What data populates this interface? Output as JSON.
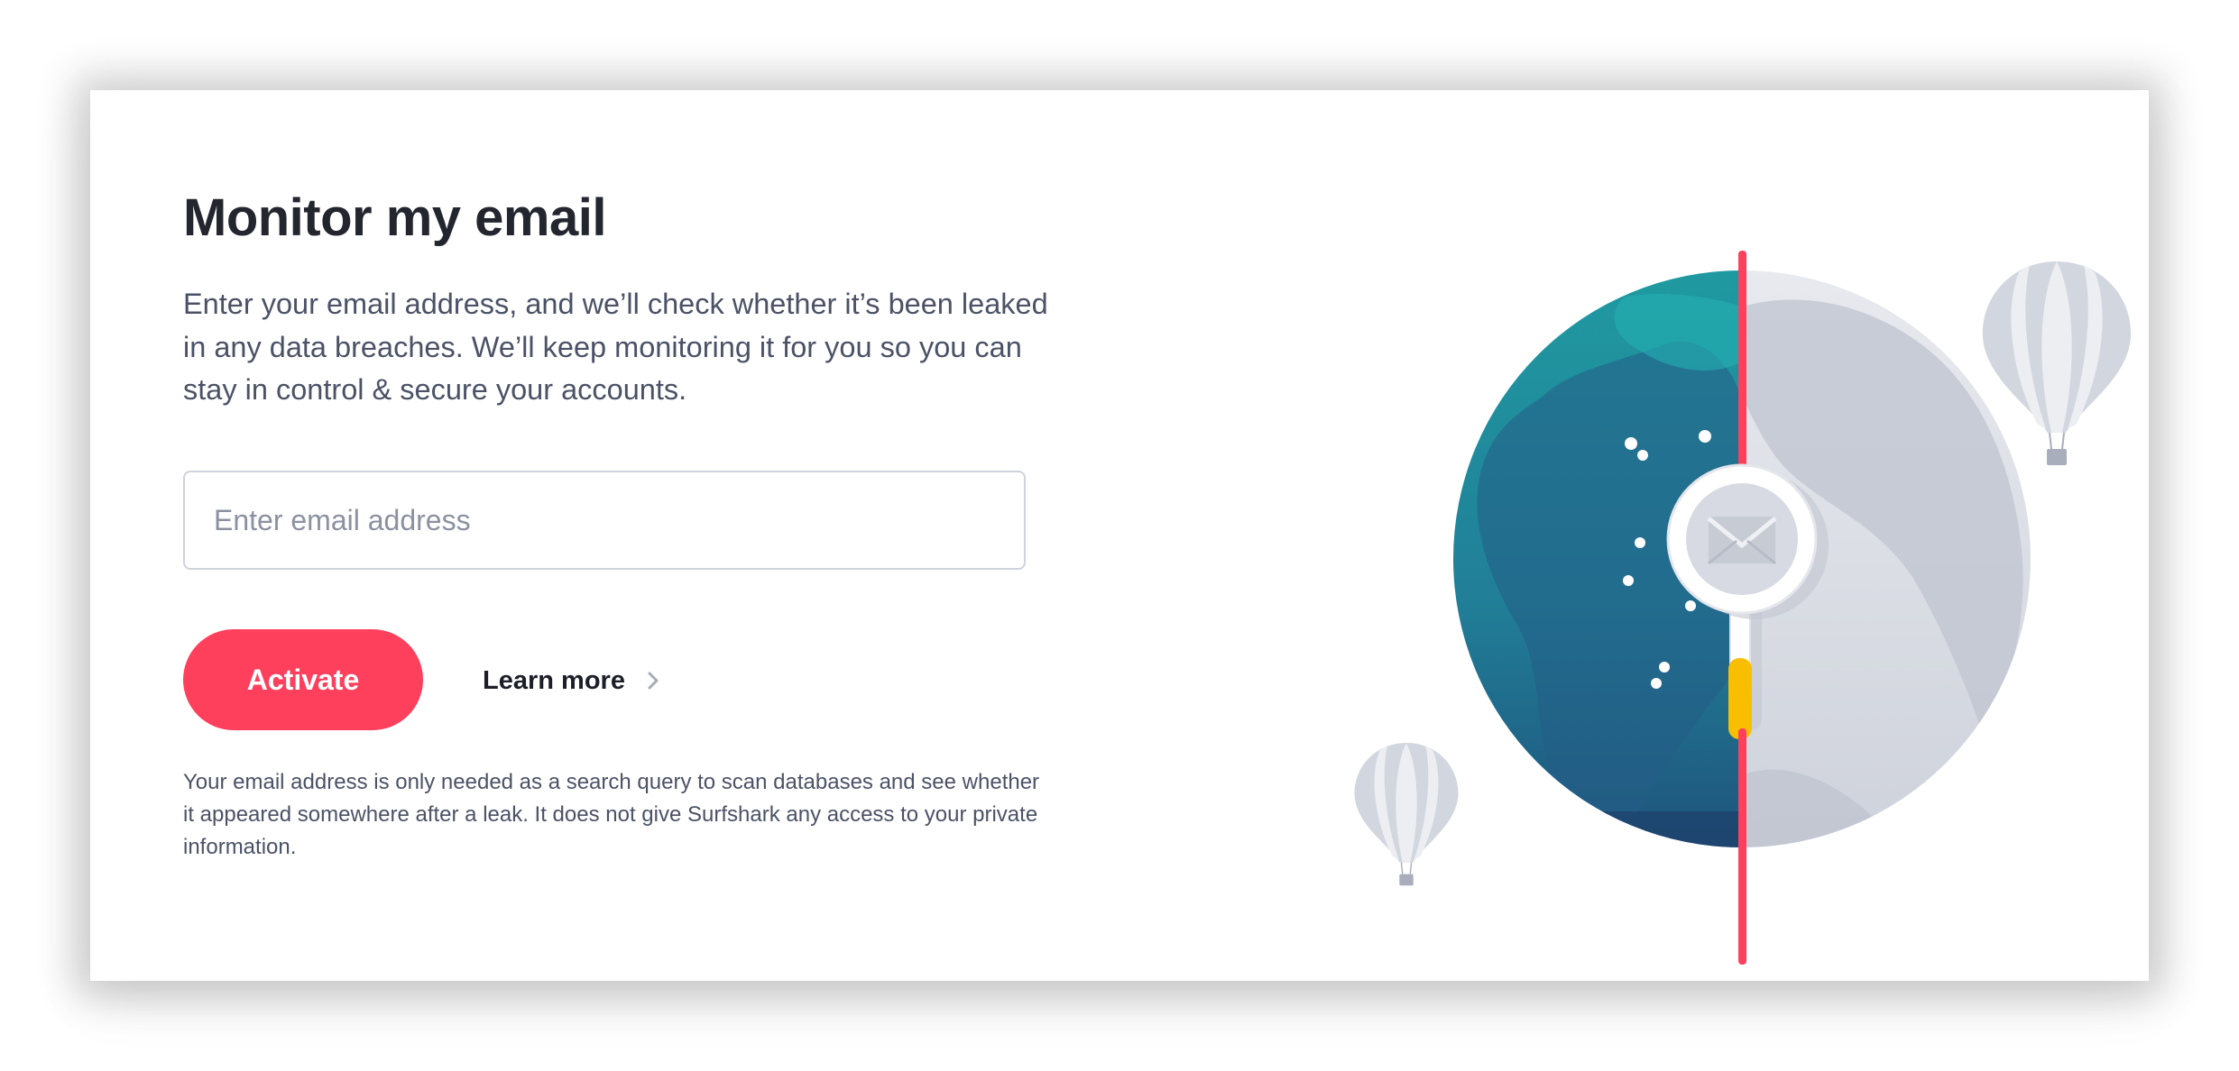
{
  "monitor": {
    "title": "Monitor my email",
    "description": "Enter your email address, and we’ll check whether it’s been leaked in any data breaches. We’ll keep monitoring it for you so you can stay in control & secure your accounts.",
    "email_placeholder": "Enter email address",
    "email_value": "",
    "activate_label": "Activate",
    "learn_more_label": "Learn more",
    "disclaimer": "Your email address is only needed as a search query to scan databases and see whether it appeared somewhere after a leak. It does not give Surfshark any access to your private information."
  },
  "theme": {
    "accent": "#ff405d",
    "title_color": "#23262e",
    "body_text": "#4b5266",
    "input_border": "#cfd3de"
  },
  "illustration": {
    "icons": [
      "globe-icon",
      "magnifier-icon",
      "envelope-icon",
      "hot-air-balloon-icon"
    ]
  }
}
